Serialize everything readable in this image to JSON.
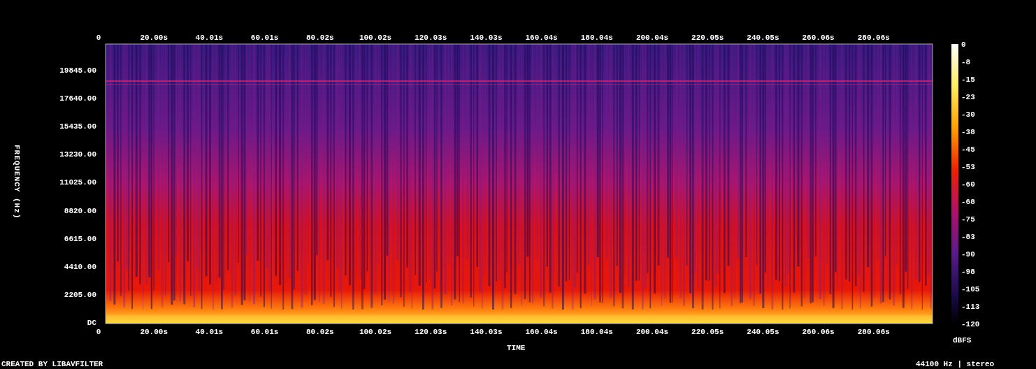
{
  "spectrogram": {
    "top_time_labels": [
      "0",
      "20.00s",
      "40.01s",
      "60.01s",
      "80.02s",
      "100.02s",
      "120.03s",
      "140.03s",
      "160.04s",
      "180.04s",
      "200.04s",
      "220.05s",
      "240.05s",
      "260.06s",
      "280.06s"
    ],
    "frequency_labels": [
      "19845.00",
      "17640.00",
      "15435.00",
      "13230.00",
      "11025.00",
      "8820.00",
      "6615.00",
      "4410.00",
      "2205.00",
      "DC"
    ],
    "bottom_time_labels": [
      "0",
      "20.00s",
      "40.01s",
      "60.01s",
      "80.02s",
      "100.02s",
      "120.03s",
      "140.03s",
      "160.04s",
      "180.04s",
      "200.04s",
      "220.05s",
      "240.05s",
      "260.06s",
      "280.06s"
    ],
    "frequency_axis_title": "FREQUENCY (Hz)",
    "time_axis_title": "TIME"
  },
  "color_scale": {
    "labels": [
      "0",
      "-8",
      "-15",
      "-23",
      "-30",
      "-38",
      "-45",
      "-53",
      "-60",
      "-68",
      "-75",
      "-83",
      "-90",
      "-98",
      "-105",
      "-113",
      "-120"
    ],
    "unit": "dBFS"
  },
  "footer": {
    "credit": "CREATED BY LIBAVFILTER",
    "format": "44100 Hz | stereo"
  }
}
